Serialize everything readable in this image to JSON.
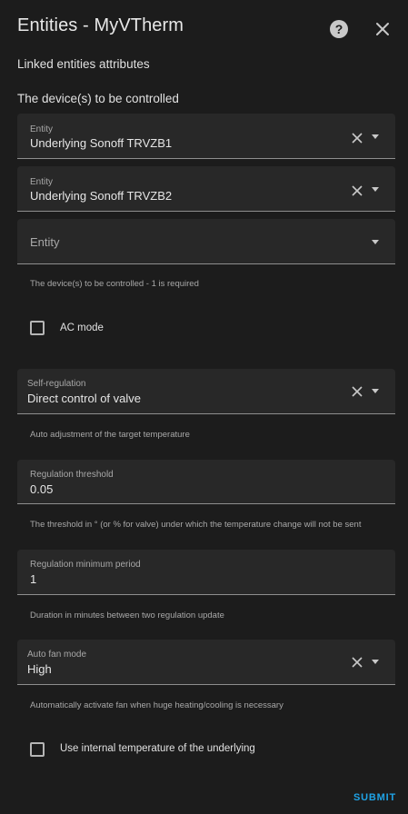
{
  "dialog": {
    "title": "Entities - MyVTherm",
    "subtitle": "Linked entities attributes",
    "submit_label": "SUBMIT",
    "help_icon": "help-circle-icon",
    "close_icon": "close-icon"
  },
  "devices": {
    "section_label": "The device(s) to be controlled",
    "entities": [
      {
        "label": "Entity",
        "value": "Underlying Sonoff TRVZB1"
      },
      {
        "label": "Entity",
        "value": "Underlying Sonoff TRVZB2"
      },
      {
        "placeholder": "Entity"
      }
    ],
    "helper": "The device(s) to be controlled - 1 is required"
  },
  "ac_mode": {
    "label": "AC mode",
    "checked": false
  },
  "self_regulation": {
    "label": "Self-regulation",
    "value": "Direct control of valve",
    "helper": "Auto adjustment of the target temperature"
  },
  "regulation_threshold": {
    "label": "Regulation threshold",
    "value": "0.05",
    "helper": "The threshold in ° (or % for valve) under which the temperature change will not be sent"
  },
  "regulation_min_period": {
    "label": "Regulation minimum period",
    "value": "1",
    "helper": "Duration in minutes between two regulation update"
  },
  "auto_fan_mode": {
    "label": "Auto fan mode",
    "value": "High",
    "helper": "Automatically activate fan when huge heating/cooling is necessary"
  },
  "internal_temp": {
    "label": "Use internal temperature of the underlying",
    "checked": false
  },
  "colors": {
    "background": "#1c1c1c",
    "field": "#282828",
    "accent": "#1fa3e6"
  }
}
